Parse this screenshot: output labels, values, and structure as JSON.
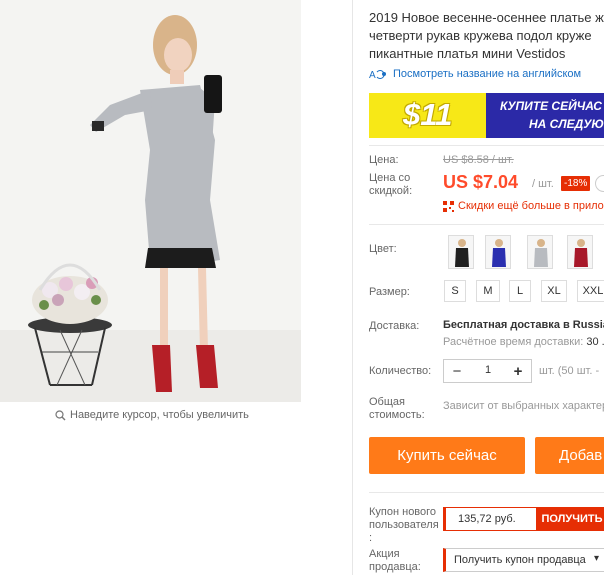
{
  "image": {
    "zoom_hint": "Наведите курсор, чтобы увеличить"
  },
  "product": {
    "title_lines": [
      "2019 Новое весенне-осеннее платье ж",
      "четверти рукав кружева подол круже",
      "пикантные платья мини Vestidos"
    ],
    "translate_link": "Посмотреть название на английском"
  },
  "banner": {
    "price": "$11",
    "cta_line1": "КУПИТЕ СЕЙЧАС",
    "cta_line2": "НА СЛЕДУЮ"
  },
  "pricing": {
    "price_label": "Цена:",
    "old_price": "US $8.58 / шт.",
    "discount_price_label_1": "Цена со",
    "discount_price_label_2": "скидкой:",
    "new_price": "US $7.04",
    "per_unit": "/ шт.",
    "discount_badge": "-18%",
    "coupon_promo": "Скидки ещё больше в прило"
  },
  "options": {
    "color_label": "Цвет:",
    "colors": [
      "black",
      "blue",
      "gray",
      "red"
    ],
    "size_label": "Размер:",
    "sizes": [
      "S",
      "M",
      "L",
      "XL",
      "XXL"
    ]
  },
  "delivery": {
    "label": "Доставка:",
    "main": "Бесплатная доставка в Russia",
    "sub_prefix": "Расчётное время доставки:",
    "sub_value": "30 ."
  },
  "quantity": {
    "label": "Количество:",
    "value": "1",
    "minus": "−",
    "plus": "+",
    "note": "шт. (50 шт. -"
  },
  "total": {
    "label_1": "Общая",
    "label_2": "стоимость:",
    "note": "Зависит от выбранных характер"
  },
  "actions": {
    "buy_now": "Купить сейчас",
    "add_to_cart": "Добав"
  },
  "new_user_coupon": {
    "label_1": "Купон нового",
    "label_2": "пользователя",
    "label_3": ":",
    "amount": "135,72 руб.",
    "get": "ПОЛУЧИТЬ"
  },
  "seller_promo": {
    "label_1": "Акция",
    "label_2": "продавца:",
    "select": "Получить купон продавца",
    "chevron": "▾"
  },
  "colors": {
    "accent_orange": "#ff7a18",
    "price_red": "#ff4b2b",
    "coupon_red": "#e62e04",
    "link_blue": "#1a6fc4",
    "banner_blue": "#2b29a7",
    "banner_yellow": "#f7e817"
  }
}
